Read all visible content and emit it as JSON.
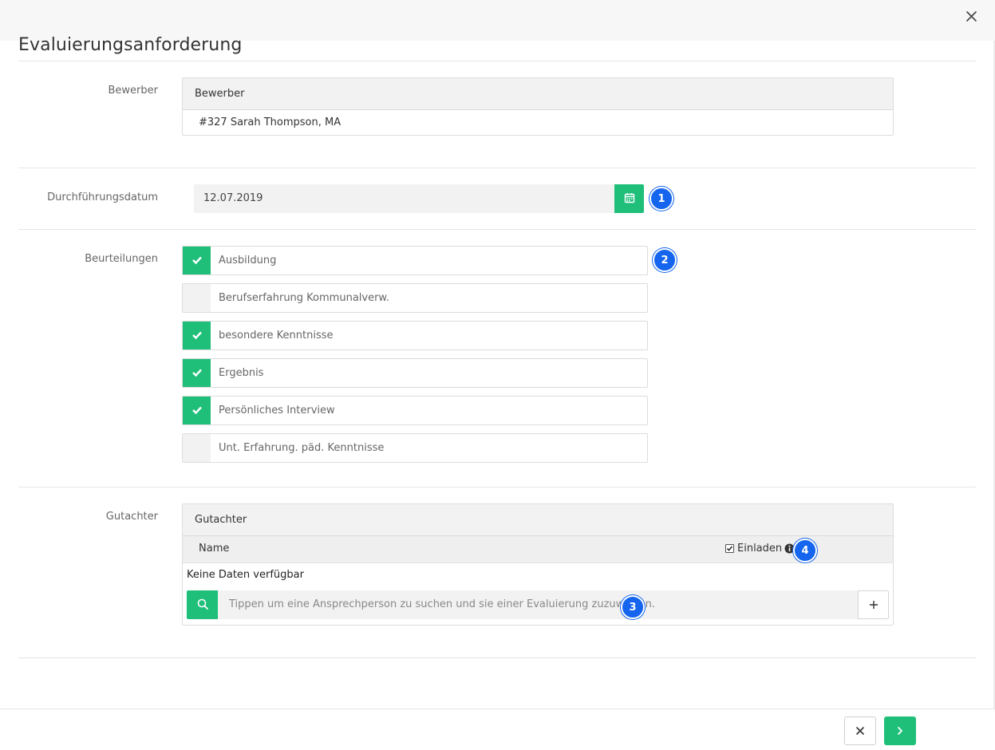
{
  "modal": {
    "title": "Evaluierungsanforderung",
    "close_icon": "close-icon"
  },
  "applicant": {
    "label": "Bewerber",
    "panel_title": "Bewerber",
    "value": "#327 Sarah Thompson, MA"
  },
  "date": {
    "label": "Durchführungsdatum",
    "value": "12.07.2019",
    "icon": "calendar-icon",
    "badge": "1"
  },
  "assessments": {
    "label": "Beurteilungen",
    "badge": "2",
    "items": [
      {
        "label": "Ausbildung",
        "checked": true
      },
      {
        "label": "Berufserfahrung Kommunalverw.",
        "checked": false
      },
      {
        "label": "besondere Kenntnisse",
        "checked": true
      },
      {
        "label": "Ergebnis",
        "checked": true
      },
      {
        "label": "Persönliches Interview",
        "checked": true
      },
      {
        "label": "Unt. Erfahrung. päd. Kenntnisse",
        "checked": false
      }
    ]
  },
  "reviewers": {
    "label": "Gutachter",
    "panel_title": "Gutachter",
    "col_name": "Name",
    "col_invite": "Einladen",
    "invite_checked": true,
    "empty": "Keine Daten verfügbar",
    "search_placeholder": "Tippen um eine Ansprechperson zu suchen und sie einer Evaluierung zuzuweisen.",
    "badge_search": "3",
    "badge_invite": "4"
  },
  "footer": {
    "cancel_icon": "close-icon",
    "next_icon": "chevron-right-icon"
  },
  "colors": {
    "accent": "#1fbf7a",
    "badge": "#1565ee"
  }
}
